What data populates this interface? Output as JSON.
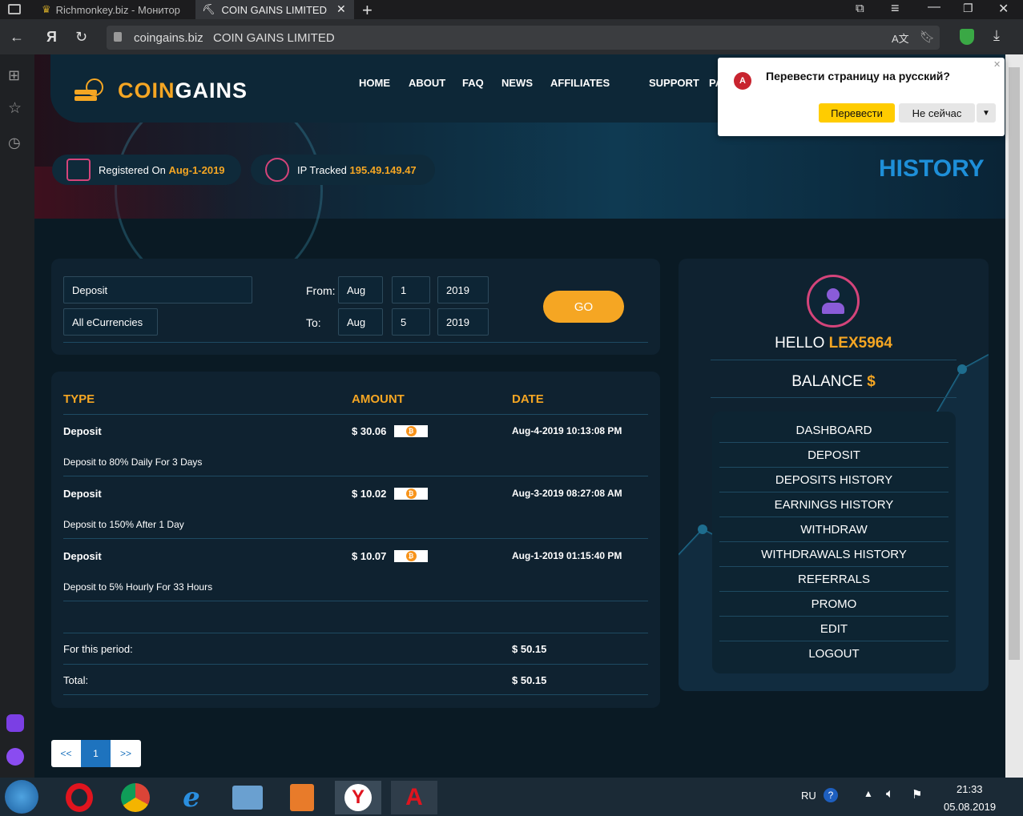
{
  "browser": {
    "tabs": [
      {
        "label": "Richmonkey.biz - Монитор"
      },
      {
        "label": "COIN GAINS LIMITED"
      }
    ],
    "url": "coingains.biz",
    "page_title": "COIN GAINS LIMITED"
  },
  "translate_popup": {
    "question": "Перевести страницу на русский?",
    "translate_btn": "Перевести",
    "not_now_btn": "Не сейчас"
  },
  "site": {
    "logo_coin": "COIN",
    "logo_gains": "GAINS",
    "nav": [
      "HOME",
      "ABOUT",
      "FAQ",
      "NEWS",
      "AFFILIATES",
      "SUPPORT",
      "PAYM"
    ],
    "registered_label": "Registered On",
    "registered_value": "Aug-1-2019",
    "ip_label": "IP Tracked",
    "ip_value": "195.49.149.47",
    "page_heading": "HISTORY"
  },
  "filter": {
    "type": "Deposit",
    "currency": "All eCurrencies",
    "from_label": "From:",
    "to_label": "To:",
    "from": {
      "month": "Aug",
      "day": "1",
      "year": "2019"
    },
    "to": {
      "month": "Aug",
      "day": "5",
      "year": "2019"
    },
    "go": "GO"
  },
  "table": {
    "headers": {
      "type": "TYPE",
      "amount": "AMOUNT",
      "date": "DATE"
    },
    "rows": [
      {
        "type": "Deposit",
        "amount": "$ 30.06",
        "date": "Aug-4-2019 10:13:08 PM",
        "desc": "Deposit to 80% Daily For 3 Days"
      },
      {
        "type": "Deposit",
        "amount": "$ 10.02",
        "date": "Aug-3-2019 08:27:08 AM",
        "desc": "Deposit to 150% After 1 Day"
      },
      {
        "type": "Deposit",
        "amount": "$ 10.07",
        "date": "Aug-1-2019 01:15:40 PM",
        "desc": "Deposit to 5% Hourly For 33 Hours"
      }
    ],
    "period_label": "For this period:",
    "period_value": "$ 50.15",
    "total_label": "Total:",
    "total_value": "$ 50.15"
  },
  "pagination": {
    "prev": "<<",
    "page": "1",
    "next": ">>"
  },
  "account": {
    "hello": "HELLO",
    "username": "LEX5964",
    "balance_label": "BALANCE",
    "balance_symbol": "$",
    "menu": [
      "DASHBOARD",
      "DEPOSIT",
      "DEPOSITS HISTORY",
      "EARNINGS HISTORY",
      "WITHDRAW",
      "WITHDRAWALS HISTORY",
      "REFERRALS",
      "PROMO",
      "EDIT",
      "LOGOUT"
    ]
  },
  "taskbar": {
    "lang": "RU",
    "time": "21:33",
    "date": "05.08.2019"
  },
  "colors": {
    "accent": "#f5a623",
    "bg": "#0a1a24",
    "card": "#0f2230"
  }
}
